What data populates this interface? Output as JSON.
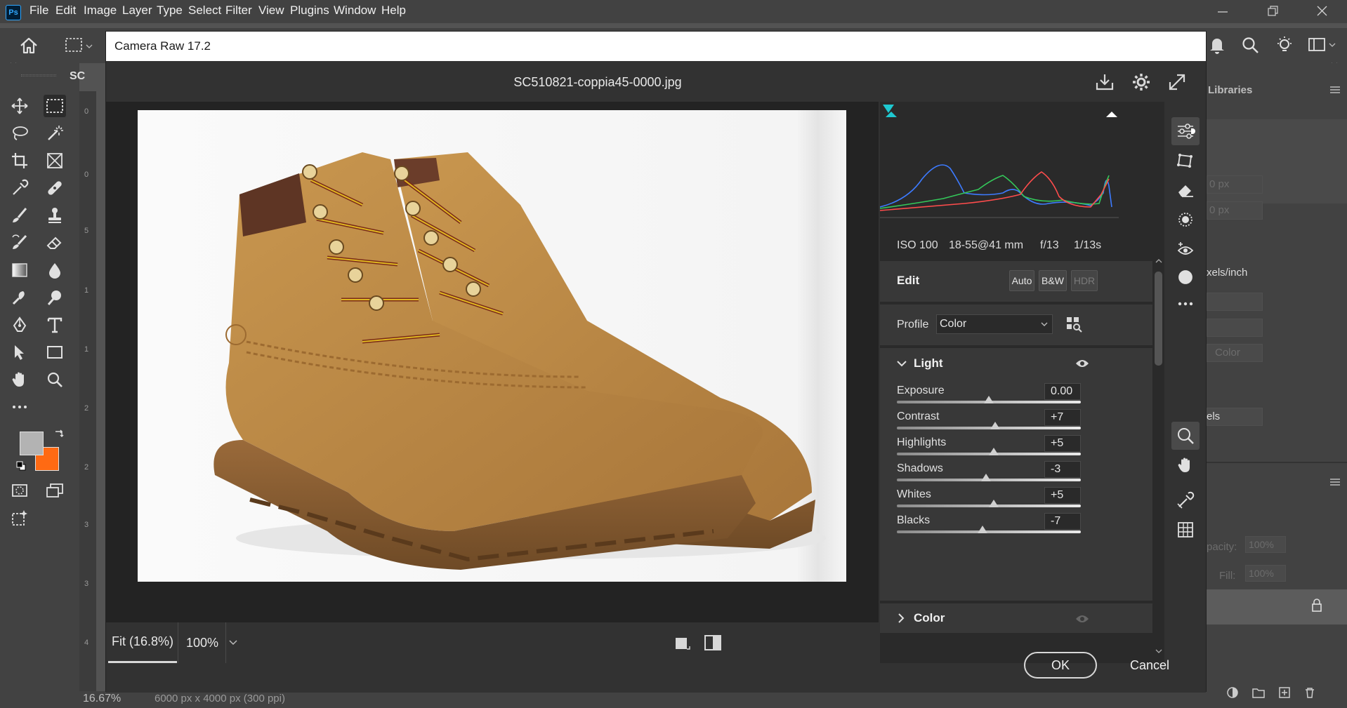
{
  "app": {
    "logo": "Ps",
    "menu": [
      "File",
      "Edit",
      "Image",
      "Layer",
      "Type",
      "Select",
      "Filter",
      "View",
      "Plugins",
      "Window",
      "Help"
    ]
  },
  "document_tab": "SC",
  "ruler_numbers": [
    "0",
    "0",
    "5",
    "1",
    "1",
    "2",
    "2",
    "3",
    "3",
    "4"
  ],
  "right_panel": {
    "tab": "Libraries",
    "px_1": "0 px",
    "px_2": "0 px",
    "resolution_unit": "xels/inch",
    "color_label": "Color",
    "els_label": "els",
    "opacity_label": "pacity:",
    "opacity_value": "100%",
    "fill_label": "Fill:",
    "fill_value": "100%"
  },
  "status": {
    "zoom": "16.67%",
    "doc_info": "6000 px x 4000 px (300 ppi)"
  },
  "camera_raw": {
    "title": "Camera Raw 17.2",
    "filename": "SC510821-coppia45-0000.jpg",
    "meta": {
      "iso": "ISO 100",
      "lens": "18-55@41 mm",
      "aperture": "f/13",
      "shutter": "1/13s"
    },
    "edit": {
      "title": "Edit",
      "auto_label": "Auto",
      "bw_label": "B&W",
      "hdr_label": "HDR",
      "profile_label": "Profile",
      "profile_value": "Color"
    },
    "light": {
      "title": "Light",
      "sliders": [
        {
          "label": "Exposure",
          "value": "0.00",
          "position": 0.5
        },
        {
          "label": "Contrast",
          "value": "+7",
          "position": 0.535
        },
        {
          "label": "Highlights",
          "value": "+5",
          "position": 0.525
        },
        {
          "label": "Shadows",
          "value": "-3",
          "position": 0.485
        },
        {
          "label": "Whites",
          "value": "+5",
          "position": 0.525
        },
        {
          "label": "Blacks",
          "value": "-7",
          "position": 0.465
        }
      ]
    },
    "color_section_title": "Color",
    "zoom": {
      "fit_label": "Fit (16.8%)",
      "pct_label": "100%"
    },
    "ok_label": "OK",
    "cancel_label": "Cancel"
  },
  "colors": {
    "accent": "#31a8ff",
    "foreground_swatch": "#b3b3b3",
    "background_swatch": "#ff6a13"
  }
}
